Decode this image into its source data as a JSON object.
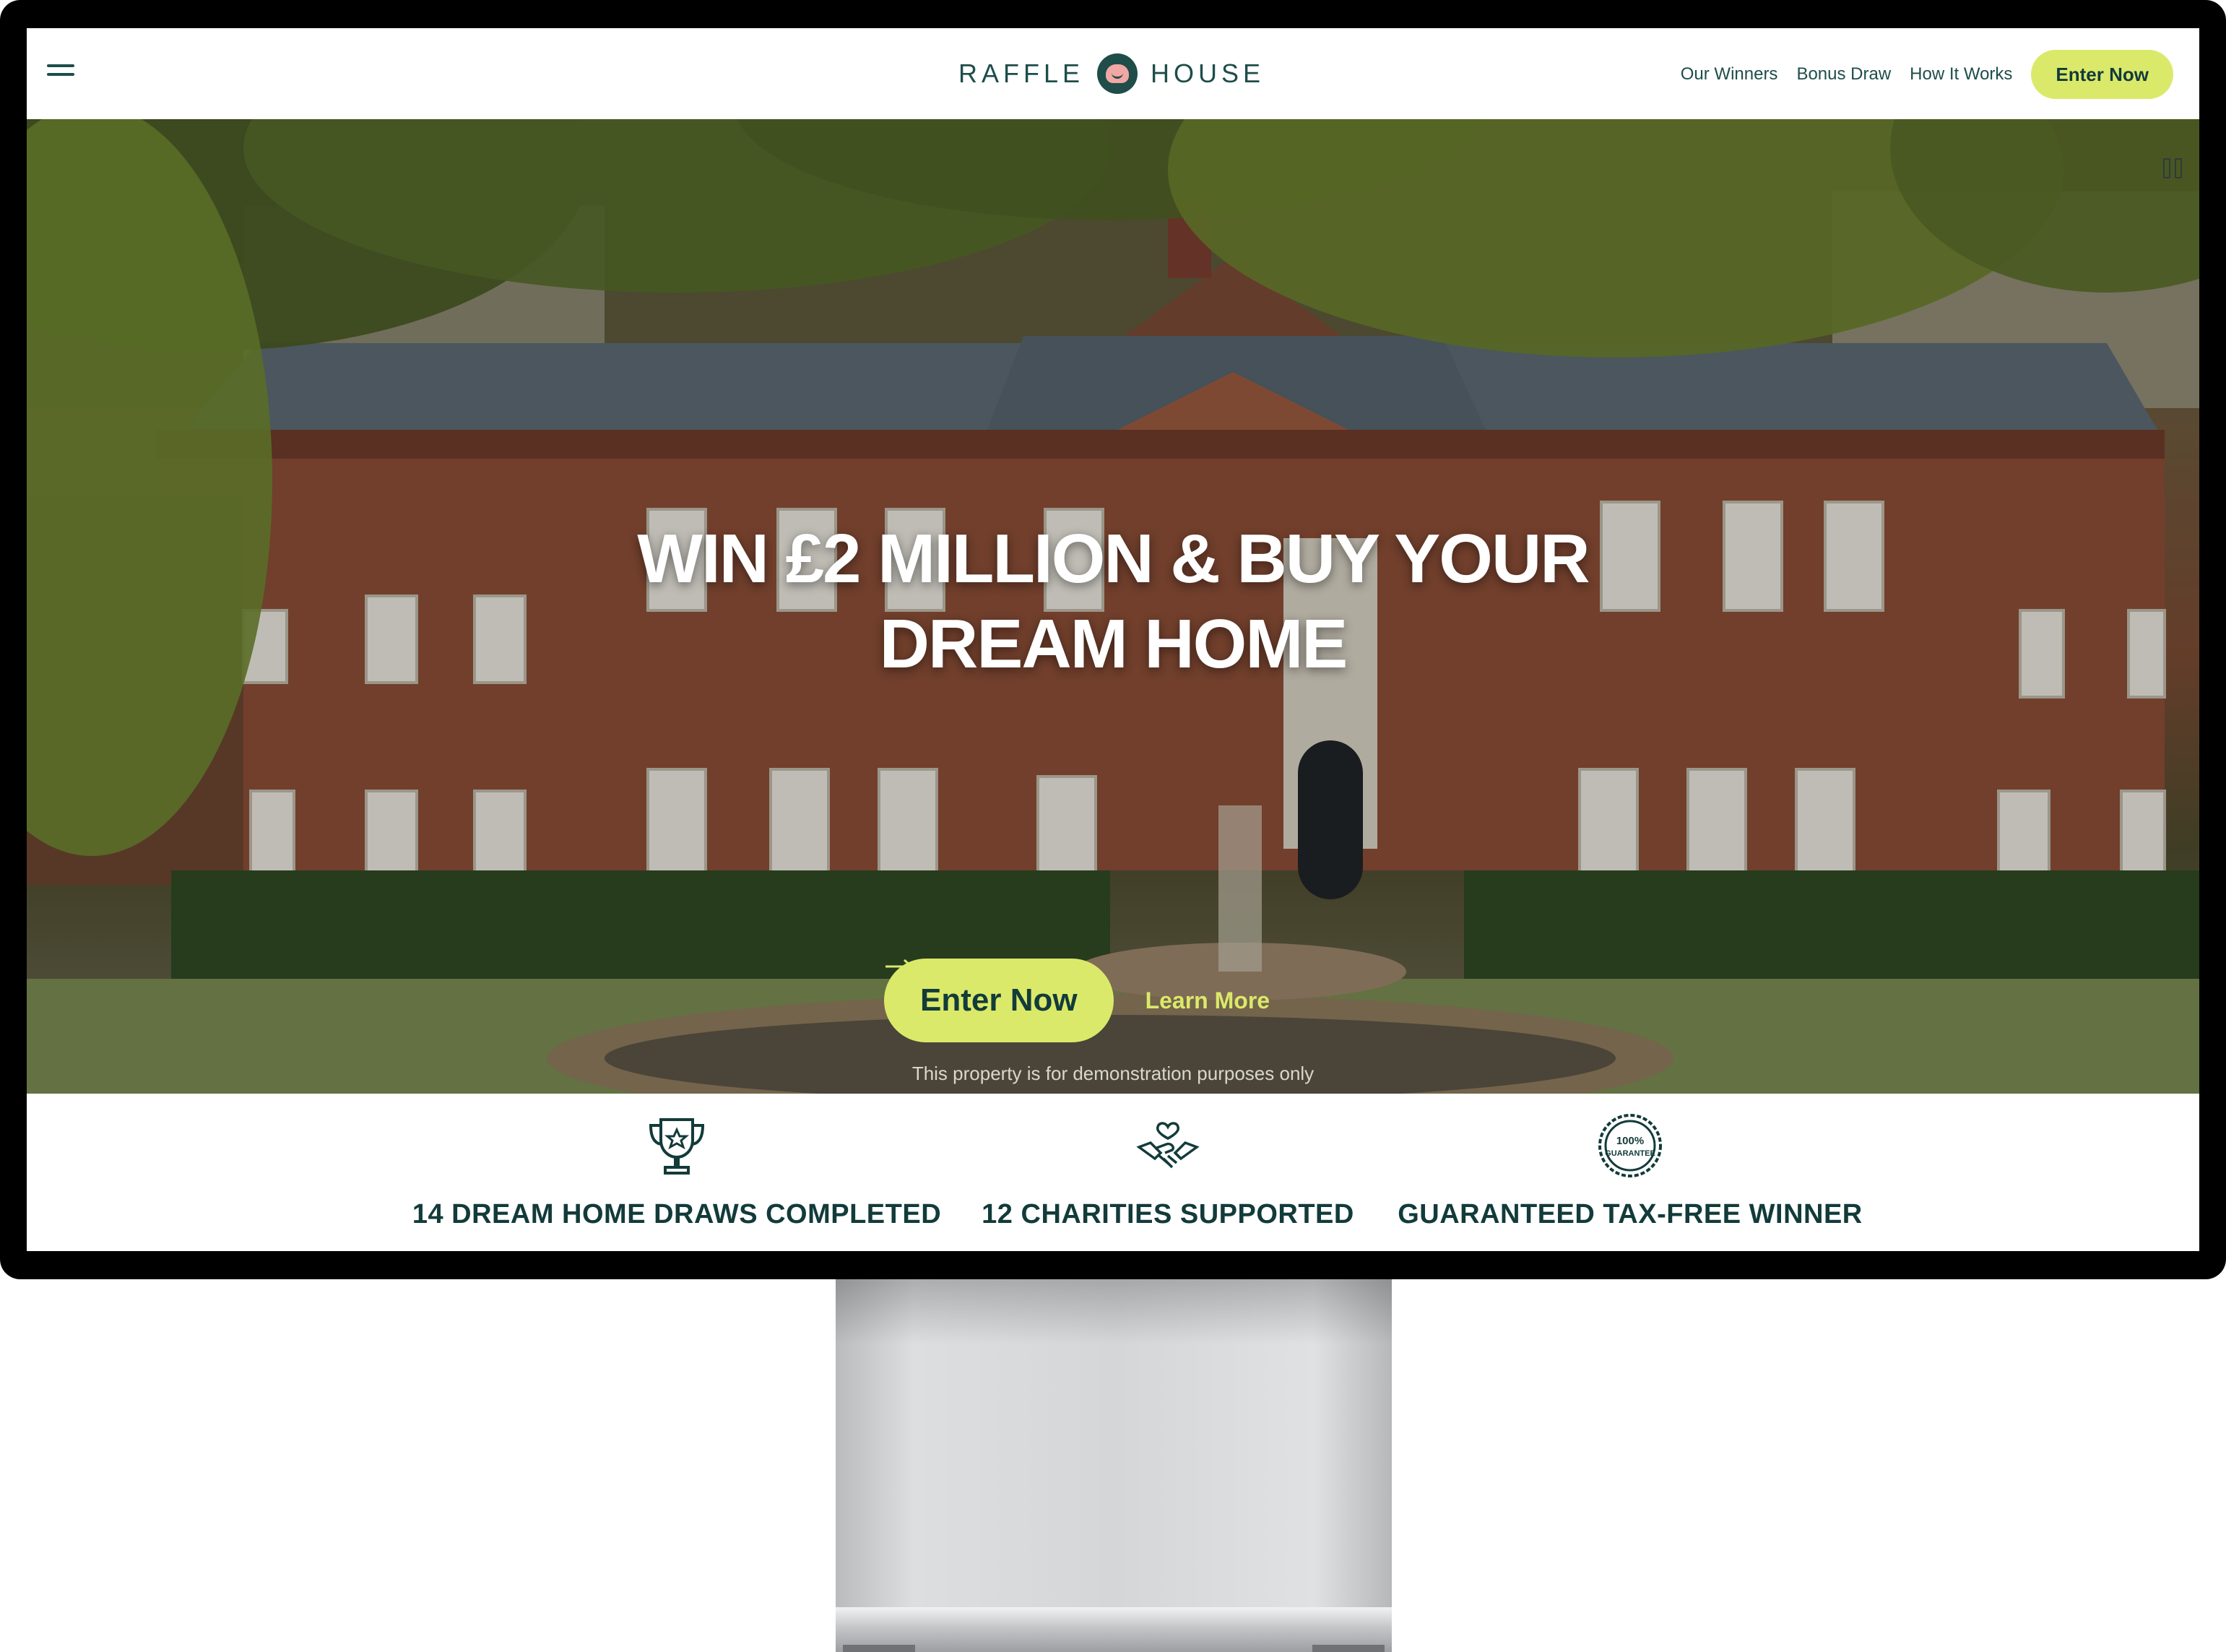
{
  "nav": {
    "brand_left": "RAFFLE",
    "brand_right": "HOUSE",
    "links": [
      "Our Winners",
      "Bonus Draw",
      "How It Works"
    ],
    "cta": "Enter Now"
  },
  "hero": {
    "title_line1": "WIN £2 MILLION & BUY YOUR",
    "title_line2": "DREAM HOME",
    "cta": "Enter Now",
    "learn_more": "Learn More",
    "disclaimer": "This property is for demonstration purposes only"
  },
  "stats": [
    {
      "label": "14 DREAM HOME DRAWS COMPLETED",
      "icon": "trophy-icon"
    },
    {
      "label": "12 CHARITIES SUPPORTED",
      "icon": "handshake-heart-icon"
    },
    {
      "label": "GUARANTEED TAX-FREE WINNER",
      "icon": "guarantee-badge-icon"
    }
  ],
  "badge_text": "100% GUARANTEE",
  "colors": {
    "brand_dark": "#1e4d4a",
    "accent_lime": "#dbe96a",
    "text_dark": "#123b3a"
  }
}
